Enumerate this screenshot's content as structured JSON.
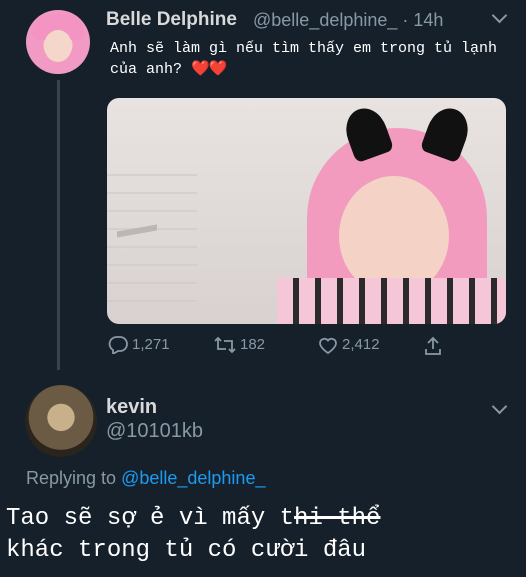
{
  "tweet": {
    "author_name": "Belle Delphine",
    "author_handle": "@belle_delphine_ · 14h",
    "caption": "Anh sẽ làm gì nếu tìm thấy em trong tủ lạnh của anh?",
    "caption_emoji": "❤️❤️",
    "stats": {
      "replies": "1,271",
      "retweets": "182",
      "likes": "2,412"
    },
    "icons": {
      "reply": "reply-icon",
      "retweet": "retweet-icon",
      "like": "heart-icon",
      "share": "share-icon",
      "menu": "chevron-down-icon"
    }
  },
  "reply_tweet": {
    "author_name": "kevin",
    "author_handle": "@10101kb",
    "replying_to_prefix": "Replying to",
    "replying_to_handle": "@belle_delphine_",
    "caption_part1": "Tao sẽ sợ ẻ vì mấy t",
    "caption_strike": "hi thể",
    "caption_part2": "khác trong tủ có cười đâu"
  },
  "colors": {
    "background": "#15202b",
    "muted_text": "#8899a6",
    "accent": "#1d9bf0"
  }
}
